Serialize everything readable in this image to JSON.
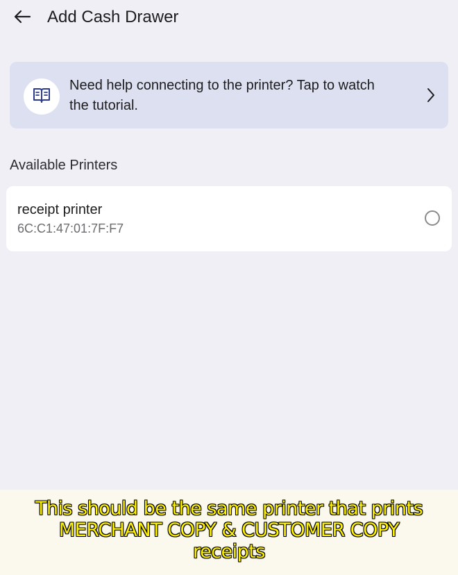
{
  "header": {
    "title": "Add Cash Drawer",
    "back_icon": "arrow-left-icon"
  },
  "help_banner": {
    "text_line1": "Need help connecting to the printer? Tap to watch",
    "text_line2": "the tutorial.",
    "icon": "book-icon",
    "chevron_icon": "chevron-right-icon",
    "background": "#dde0f1",
    "icon_color": "#2b3a8f"
  },
  "available_printers": {
    "label": "Available Printers",
    "items": [
      {
        "name": "receipt printer",
        "mac": "6C:C1:47:01:7F:F7",
        "selected": false
      }
    ]
  },
  "caption": {
    "line1": "This should be the same printer that prints",
    "line2": "MERCHANT COPY & CUSTOMER COPY",
    "line3": "receipts",
    "color": "#fff200"
  }
}
